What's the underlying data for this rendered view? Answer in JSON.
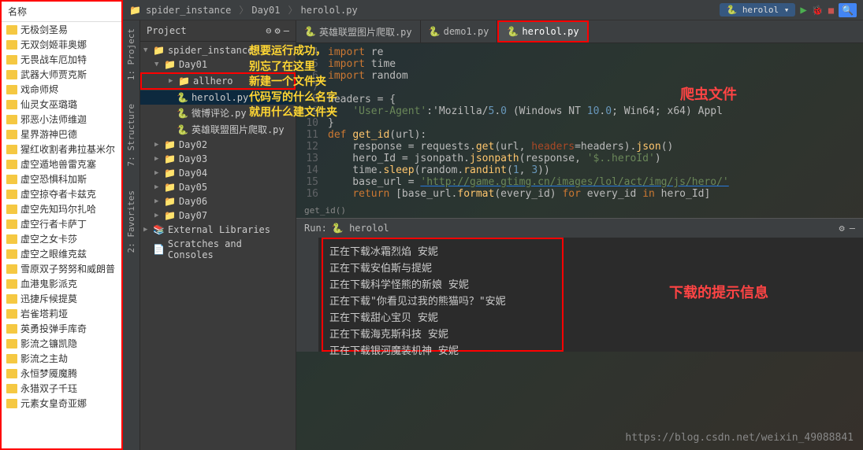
{
  "explorer": {
    "header": "名称",
    "items": [
      "无极剑圣易",
      "无双剑姬菲奥娜",
      "无畏战车厄加特",
      "武器大师贾克斯",
      "戏命师烬",
      "仙灵女巫璐璐",
      "邪恶小法师维迦",
      "星界游神巴德",
      "猩红收割者弗拉基米尔",
      "虚空遁地兽雷克塞",
      "虚空恐惧科加斯",
      "虚空掠夺者卡兹克",
      "虚空先知玛尔扎哈",
      "虚空行者卡萨丁",
      "虚空之女卡莎",
      "虚空之眼维克兹",
      "雪原双子努努和威朗普",
      "血港鬼影派克",
      "迅捷斥候提莫",
      "岩雀塔莉垭",
      "英勇投弹手库奇",
      "影流之镰凯隐",
      "影流之主劫",
      "永恒梦魇魔腾",
      "永猎双子千珏",
      "元素女皇奇亚娜"
    ]
  },
  "breadcrumbs": [
    "spider_instance",
    "Day01",
    "herolol.py"
  ],
  "run_config": "herolol",
  "left_tabs": [
    "1: Project",
    "7: Structure",
    "2: Favorites"
  ],
  "project_panel": {
    "title": "Project",
    "tree": [
      {
        "label": "spider_instance",
        "type": "folder",
        "indent": 0,
        "arrow": "▼"
      },
      {
        "label": "Day01",
        "type": "folder",
        "indent": 1,
        "arrow": "▼"
      },
      {
        "label": "allhero",
        "type": "folder",
        "indent": 2,
        "arrow": "▶",
        "boxed": true
      },
      {
        "label": "herolol.py",
        "type": "py",
        "indent": 2,
        "sel": true
      },
      {
        "label": "微博评论.py",
        "type": "py",
        "indent": 2
      },
      {
        "label": "英雄联盟图片爬取.py",
        "type": "py",
        "indent": 2
      },
      {
        "label": "Day02",
        "type": "folder",
        "indent": 1,
        "arrow": "▶"
      },
      {
        "label": "Day03",
        "type": "folder",
        "indent": 1,
        "arrow": "▶"
      },
      {
        "label": "Day04",
        "type": "folder",
        "indent": 1,
        "arrow": "▶"
      },
      {
        "label": "Day05",
        "type": "folder",
        "indent": 1,
        "arrow": "▶"
      },
      {
        "label": "Day06",
        "type": "folder",
        "indent": 1,
        "arrow": "▶"
      },
      {
        "label": "Day07",
        "type": "folder",
        "indent": 1,
        "arrow": "▶"
      },
      {
        "label": "External Libraries",
        "type": "lib",
        "indent": 0,
        "arrow": "▶"
      },
      {
        "label": "Scratches and Consoles",
        "type": "scratch",
        "indent": 0
      }
    ]
  },
  "tabs": [
    {
      "label": "英雄联盟图片爬取.py",
      "active": false
    },
    {
      "label": "demo1.py",
      "active": false
    },
    {
      "label": "herolol.py",
      "active": true
    }
  ],
  "code_lines": [
    {
      "n": 4,
      "content": "import re"
    },
    {
      "n": 5,
      "content": "import time"
    },
    {
      "n": 6,
      "content": "import random"
    },
    {
      "n": 7,
      "content": ""
    },
    {
      "n": 8,
      "content": "headers = {"
    },
    {
      "n": 9,
      "content": "    'User-Agent':'Mozilla/5.0 (Windows NT 10.0; Win64; x64) Appl"
    },
    {
      "n": 10,
      "content": "}"
    },
    {
      "n": 11,
      "content": "def get_id(url):"
    },
    {
      "n": 12,
      "content": "    response = requests.get(url, headers=headers).json()"
    },
    {
      "n": 13,
      "content": "    hero_Id = jsonpath.jsonpath(response, '$..heroId')"
    },
    {
      "n": 14,
      "content": "    time.sleep(random.randint(1, 3))"
    },
    {
      "n": 15,
      "content": "    base_url = 'http://game.gtimg.cn/images/lol/act/img/js/hero/'"
    },
    {
      "n": 16,
      "content": "    return [base_url.format(every_id) for every_id in hero_Id]"
    }
  ],
  "editor_breadcrumb": "get_id()",
  "annotations": {
    "yellow": "想要运行成功，\n别忘了在这里\n新建一个文件夹\n代码写的什么名字\n就用什么建文件夹",
    "red1": "爬虫文件",
    "red2": "下载的提示信息"
  },
  "run": {
    "label": "Run:",
    "name": "herolol",
    "output": [
      "正在下载冰霜烈焰  安妮",
      "正在下载安伯斯与提妮",
      "正在下载科学怪熊的新娘  安妮",
      "正在下载\"你看见过我的熊猫吗？\"安妮",
      "正在下载甜心宝贝  安妮",
      "正在下载海克斯科技  安妮",
      "正在下载银河魔装机神  安妮"
    ]
  },
  "watermark": "https://blog.csdn.net/weixin_49088841"
}
